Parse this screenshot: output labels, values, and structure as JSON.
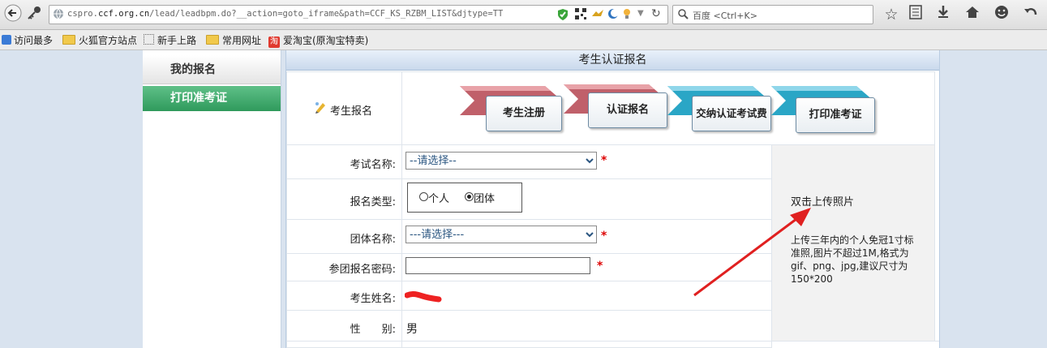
{
  "browser": {
    "url_host_prefix": "cspro.",
    "url_host": "ccf.org.cn",
    "url_path": "/lead/leadbpm.do?__action=goto_iframe&path=CCF_KS_RZBM_LIST&djtype=TT",
    "search_placeholder": "百度 <Ctrl+K>",
    "bookmarks": [
      "访问最多",
      "火狐官方站点",
      "新手上路",
      "常用网址",
      "爱淘宝(原淘宝特卖)"
    ],
    "bookmark_badge": "淘"
  },
  "left_nav": {
    "items": [
      {
        "label": "我的报名",
        "active": false
      },
      {
        "label": "打印准考证",
        "active": true
      }
    ]
  },
  "panel": {
    "title": "考生认证报名",
    "header_label": "考生报名",
    "steps": [
      "考生注册",
      "认证报名",
      "交纳认证考试费",
      "打印准考证"
    ]
  },
  "form": {
    "exam_name": {
      "label": "考试名称:",
      "value": "--请选择--"
    },
    "reg_type": {
      "label": "报名类型:",
      "options": [
        "个人",
        "团体"
      ],
      "selected": "团体"
    },
    "group_name": {
      "label": "团体名称:",
      "value": "---请选择---"
    },
    "group_password": {
      "label": "参团报名密码:",
      "value": ""
    },
    "candidate_name": {
      "label": "考生姓名:"
    },
    "gender": {
      "label": "性　　别:",
      "value": "男"
    },
    "required_mark": "*"
  },
  "photo": {
    "title": "双击上传照片",
    "hint": "上传三年内的个人免冠1寸标准照,图片不超过1M,格式为gif、png、jpg,建议尺寸为150*200"
  },
  "colors": {
    "active_nav": "#3da56a",
    "required": "#dd0000",
    "annotation": "#e02020",
    "step_red": "#c0606a",
    "step_blue": "#2aa6c6"
  }
}
